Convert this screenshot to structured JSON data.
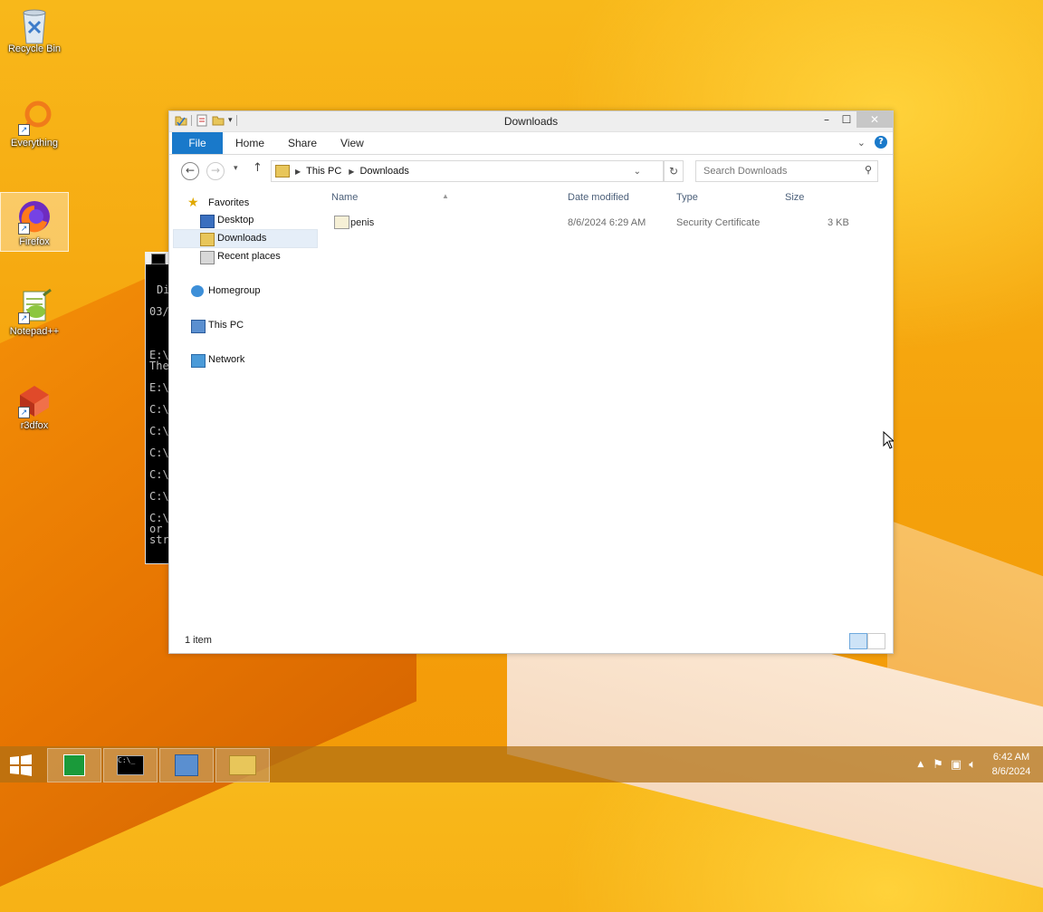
{
  "desktop": {
    "icons": [
      {
        "label": "Recycle Bin",
        "icon": "recycle-bin-icon"
      },
      {
        "label": "Everything",
        "icon": "everything-search-icon"
      },
      {
        "label": "Firefox",
        "icon": "firefox-icon"
      },
      {
        "label": "Notepad++",
        "icon": "notepad-plus-plus-icon"
      },
      {
        "label": "r3dfox",
        "icon": "r3dfox-icon"
      }
    ]
  },
  "window": {
    "title": "Downloads",
    "ribbon": {
      "file": "File",
      "tabs": [
        "Home",
        "Share",
        "View"
      ],
      "help": "?"
    },
    "address": {
      "segments": [
        "This PC",
        "Downloads"
      ]
    },
    "search": {
      "placeholder": "Search Downloads"
    },
    "nav": {
      "favorites": "Favorites",
      "desktop": "Desktop",
      "downloads": "Downloads",
      "recent": "Recent places",
      "homegroup": "Homegroup",
      "this_pc": "This PC",
      "network": "Network"
    },
    "columns": {
      "name": "Name",
      "date": "Date modified",
      "type": "Type",
      "size": "Size"
    },
    "files": [
      {
        "name": "penis",
        "date": "8/6/2024 6:29 AM",
        "type": "Security Certificate",
        "size": "3 KB"
      }
    ],
    "status": "1 item"
  },
  "cmd": {
    "lines": [
      "Di",
      "03/",
      "E:\\",
      "The",
      "E:\\",
      "C:\\",
      "C:\\",
      "C:\\",
      "C:\\",
      "C:\\",
      "C:\\",
      "or",
      "str"
    ]
  },
  "taskbar": {
    "time": "6:42 AM",
    "date": "8/6/2024"
  },
  "colors": {
    "accent": "#1979ca",
    "taskbar": "#b07014"
  }
}
